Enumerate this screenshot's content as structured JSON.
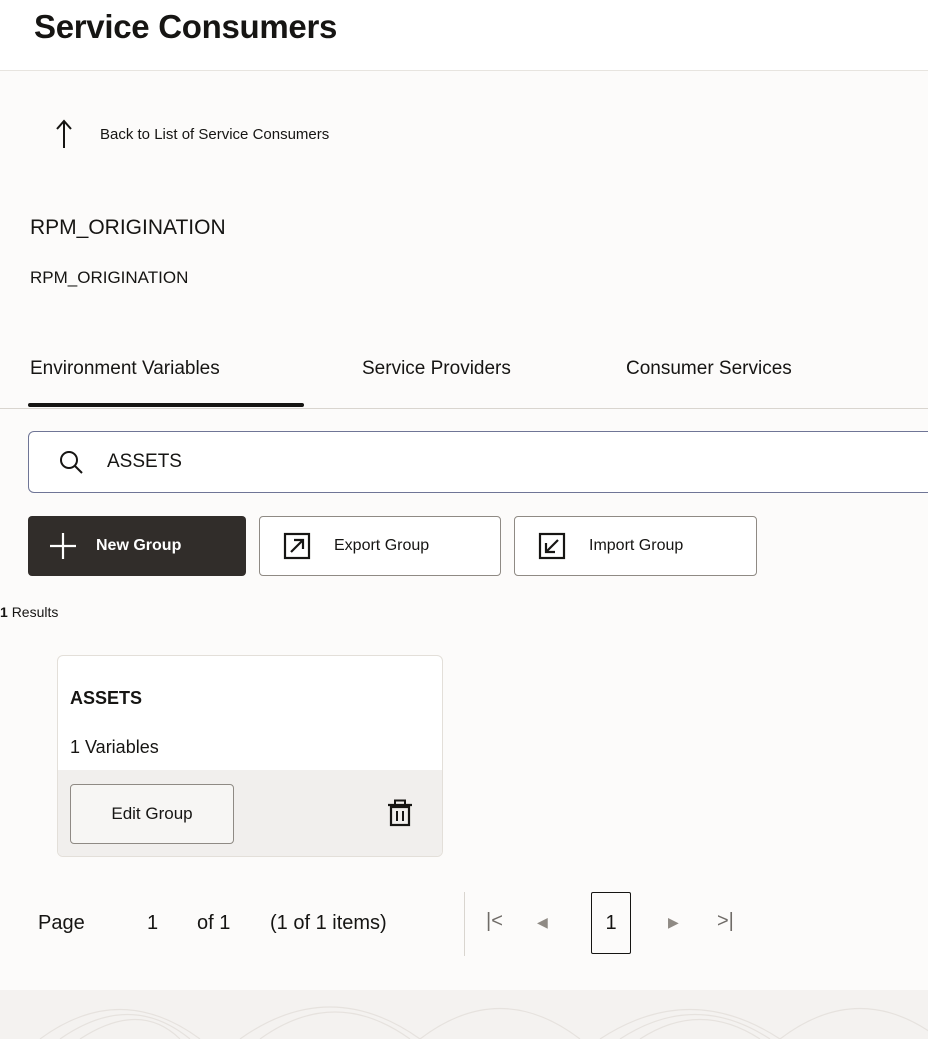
{
  "header": {
    "title": "Service Consumers"
  },
  "back_link": {
    "label": "Back to List of Service Consumers",
    "icon": "arrow-up-icon"
  },
  "record": {
    "title": "RPM_ORIGINATION",
    "subtitle": "RPM_ORIGINATION"
  },
  "tabs": [
    {
      "label": "Environment Variables",
      "selected": true
    },
    {
      "label": "Service Providers",
      "selected": false
    },
    {
      "label": "Consumer Services",
      "selected": false
    }
  ],
  "search": {
    "value": "ASSETS",
    "icon": "search-icon"
  },
  "toolbar": {
    "new_label": "New Group",
    "export_label": "Export Group",
    "import_label": "Import Group"
  },
  "results": {
    "count": "1",
    "label": "Results"
  },
  "groups": [
    {
      "name": "ASSETS",
      "count_text": "1 Variables",
      "edit_label": "Edit Group"
    }
  ],
  "pagination": {
    "page_label": "Page",
    "current_page": "1",
    "of_text": "of 1",
    "items_text": "(1 of 1 items)",
    "page_button": "1"
  },
  "colors": {
    "primary_button": "#312d2a",
    "search_border": "#6f7596",
    "background": "#fcfbfa"
  }
}
